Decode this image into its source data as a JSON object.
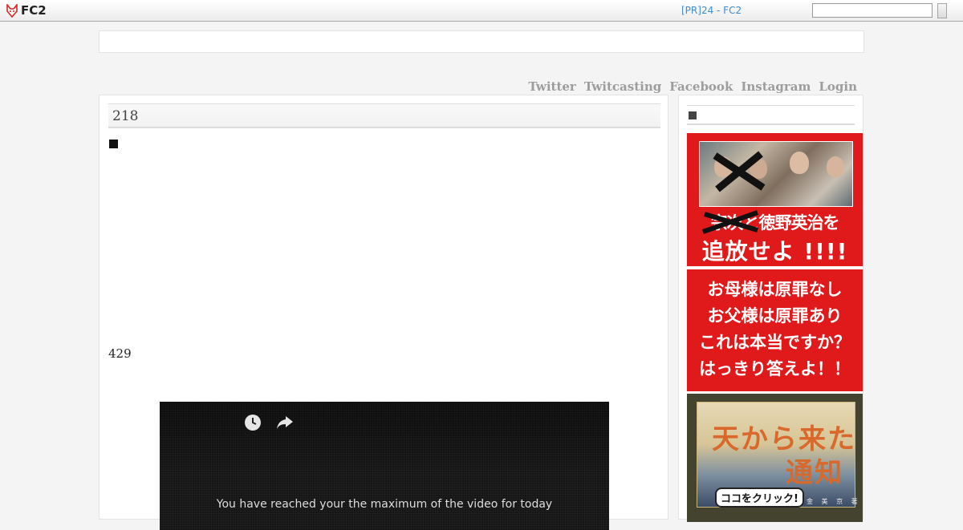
{
  "topbar": {
    "logo_text": "FC2",
    "pr_link": "[PR]24 - FC2",
    "search_placeholder": ""
  },
  "nav": {
    "items": [
      "Twitter",
      "Twitcasting",
      "Facebook",
      "Instagram",
      "Login"
    ]
  },
  "main": {
    "entry_title": "218",
    "count": "429",
    "video": {
      "message": "You have reached your the maximum of the video for today"
    }
  },
  "sidebar": {
    "banner1": {
      "line1": "宗次と徳野英治を",
      "line2": "追放せよ !!!!"
    },
    "banner2": {
      "lines": [
        "お母様は原罪なし",
        "お父様は原罪あり",
        "これは本当ですか？",
        "はっきり答えよ！！"
      ]
    },
    "banner3": {
      "title1": "天から来た",
      "title2": "通知",
      "click": "ココをクリック!",
      "author": "金 美 京 著"
    }
  },
  "colors": {
    "accent_link": "#3d8ccc",
    "banner_red": "#e0191b",
    "nav_gray": "#9d9d9d"
  }
}
